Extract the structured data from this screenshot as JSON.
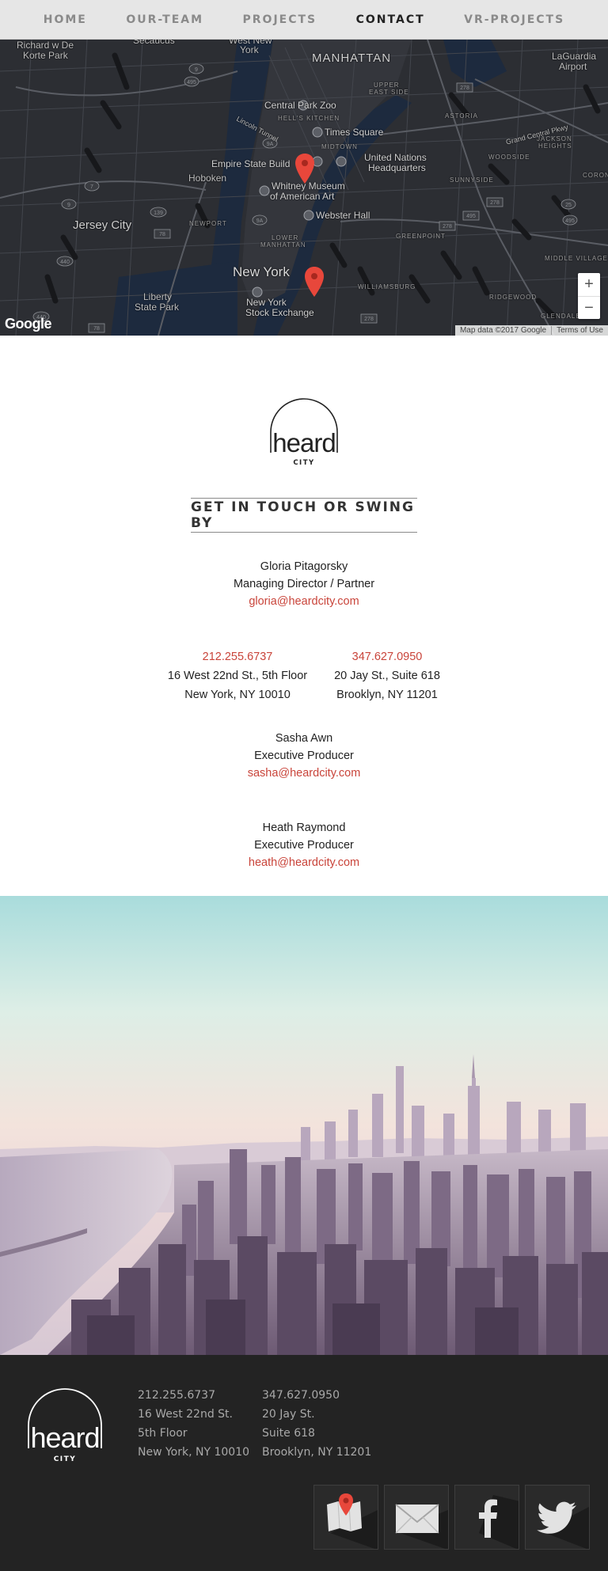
{
  "nav": {
    "items": [
      "HOME",
      "OUR-TEAM",
      "PROJECTS",
      "CONTACT",
      "VR-PROJECTS"
    ],
    "active_index": 3
  },
  "map": {
    "labels": {
      "richard": "Richard w De",
      "korte": "Korte Park",
      "secaucus": "Secaucus",
      "westnew": "West New",
      "york": "York",
      "manhattan": "MANHATTAN",
      "laguardia": "LaGuardia",
      "airport": "Airport",
      "upper": "UPPER",
      "eastside": "EAST SIDE",
      "astoria": "ASTORIA",
      "centralpark": "Central Park Zoo",
      "hellskitchen": "HELL'S KITCHEN",
      "lincoln": "Lincoln Tunnel",
      "timessq": "Times Square",
      "jackson": "JACKSON",
      "heights": "HEIGHTS",
      "midtown": "MIDTOWN",
      "un1": "United Nations",
      "un2": "Headquarters",
      "woodside": "WOODSIDE",
      "esb": "Empire State Build",
      "hoboken": "Hoboken",
      "whitney1": "Whitney Museum",
      "whitney2": "of American Art",
      "sunnyside": "SUNNYSIDE",
      "corona": "CORONA",
      "jerseycity": "Jersey City",
      "newport": "NEWPORT",
      "webster": "Webster Hall",
      "greenpoint": "GREENPOINT",
      "lower1": "LOWER",
      "lower2": "MANHATTAN",
      "newyork": "New York",
      "williamsburg": "WILLIAMSBURG",
      "middle": "MIDDLE VILLAGE",
      "liberty1": "Liberty",
      "liberty2": "State Park",
      "nyse1": "New York",
      "nyse2": "Stock Exchange",
      "ridgewood": "RIDGEWOOD",
      "glendale": "GLENDALE",
      "grandcentral": "Grand Central Pkwy"
    },
    "zoom_in": "+",
    "zoom_out": "−",
    "google": "Google",
    "attribution": "Map data ©2017 Google",
    "terms": "Terms of Use"
  },
  "brand": {
    "word": "heard",
    "sub": "CITY"
  },
  "contact": {
    "heading": "GET IN TOUCH OR SWING BY",
    "gloria": {
      "name": "Gloria Pitagorsky",
      "title": "Managing Director / Partner",
      "email": "gloria@heardcity.com"
    },
    "offices": [
      {
        "phone": "212.255.6737",
        "line1": "16 West 22nd St., 5th Floor",
        "line2": "New York, NY 10010"
      },
      {
        "phone": "347.627.0950",
        "line1": "20 Jay St., Suite 618",
        "line2": "Brooklyn, NY 11201"
      }
    ],
    "sasha": {
      "name": "Sasha Awn",
      "title": "Executive Producer",
      "email": "sasha@heardcity.com"
    },
    "heath": {
      "name": "Heath Raymond",
      "title": "Executive Producer",
      "email": "heath@heardcity.com"
    }
  },
  "footer": {
    "col1": [
      "212.255.6737",
      "16 West 22nd St.",
      "5th Floor",
      "New York, NY 10010"
    ],
    "col2": [
      "347.627.0950",
      "20 Jay St.",
      "Suite 618",
      "Brooklyn, NY 11201"
    ],
    "social": [
      "map-icon",
      "mail-icon",
      "facebook-icon",
      "twitter-icon"
    ]
  },
  "colors": {
    "accent": "#c9443a",
    "nav_bg": "#e6e6e6",
    "map_bg": "#2b2d31",
    "footer_bg": "#232323"
  }
}
